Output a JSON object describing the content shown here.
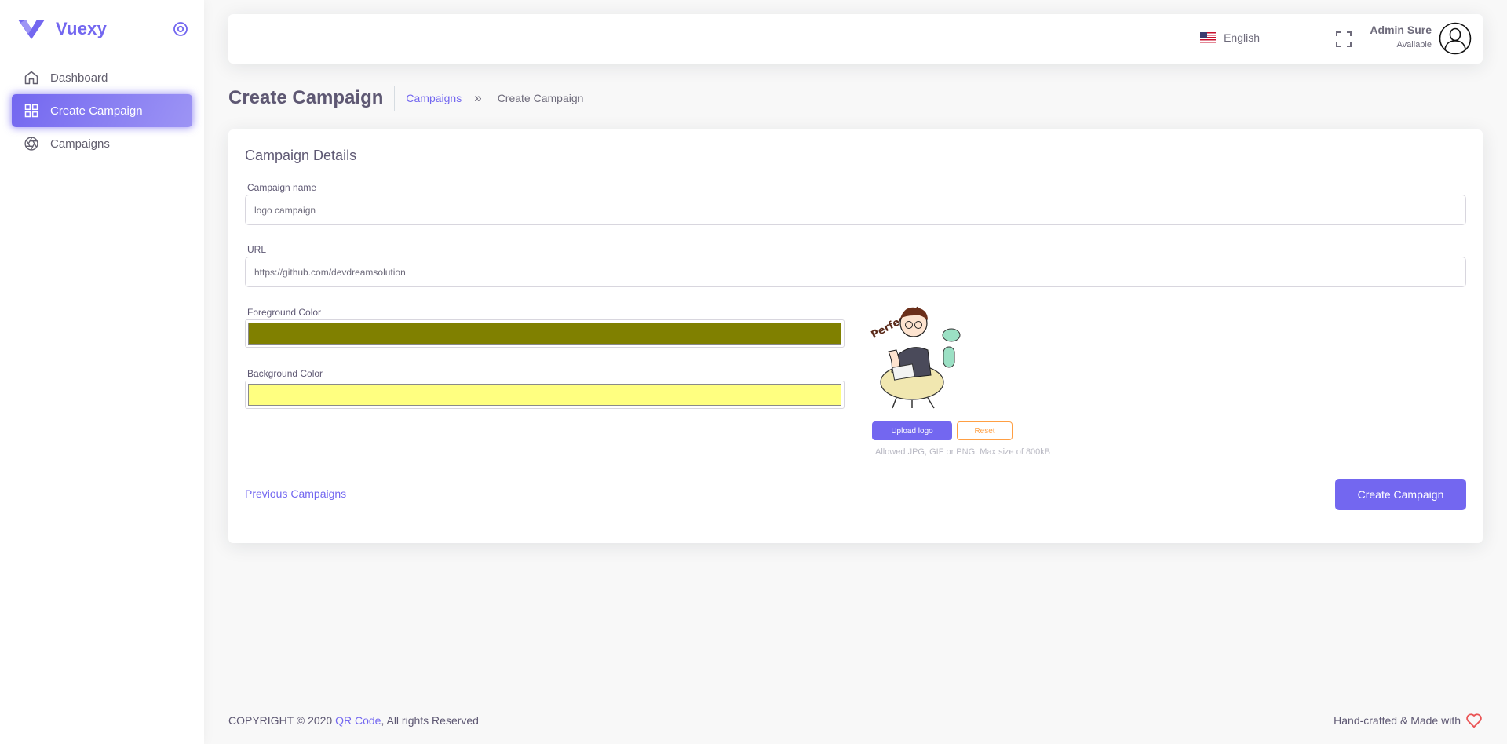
{
  "app": {
    "brand": "Vuexy"
  },
  "sidebar": {
    "items": [
      {
        "label": "Dashboard",
        "icon": "home-icon",
        "active": false
      },
      {
        "label": "Create Campaign",
        "icon": "grid-icon",
        "active": true
      },
      {
        "label": "Campaigns",
        "icon": "aperture-icon",
        "active": false
      }
    ]
  },
  "navbar": {
    "language": "English",
    "user_name": "Admin Sure",
    "user_status": "Available"
  },
  "header": {
    "title": "Create Campaign",
    "breadcrumb_link": "Campaigns",
    "breadcrumb_sep": "»",
    "breadcrumb_current": "Create Campaign"
  },
  "form": {
    "card_title": "Campaign Details",
    "name_label": "Campaign name",
    "name_value": "logo campaign",
    "url_label": "URL",
    "url_value": "https://github.com/devdreamsolution",
    "fg_label": "Foreground Color",
    "fg_color": "#808000",
    "bg_label": "Background Color",
    "bg_color": "#ffff80",
    "logo_caption": "Perfect!!!",
    "upload_label": "Upload logo",
    "reset_label": "Reset",
    "upload_hint": "Allowed JPG, GIF or PNG. Max size of 800kB",
    "prev_link": "Previous Campaigns",
    "submit_label": "Create Campaign"
  },
  "footer": {
    "copyright_prefix": "COPYRIGHT © 2020 ",
    "brand": "QR Code",
    "copyright_suffix": ", All rights Reserved",
    "made_with": "Hand-crafted & Made with"
  },
  "colors": {
    "primary": "#7367f0",
    "warning": "#ff9f43",
    "danger": "#ea5455"
  }
}
